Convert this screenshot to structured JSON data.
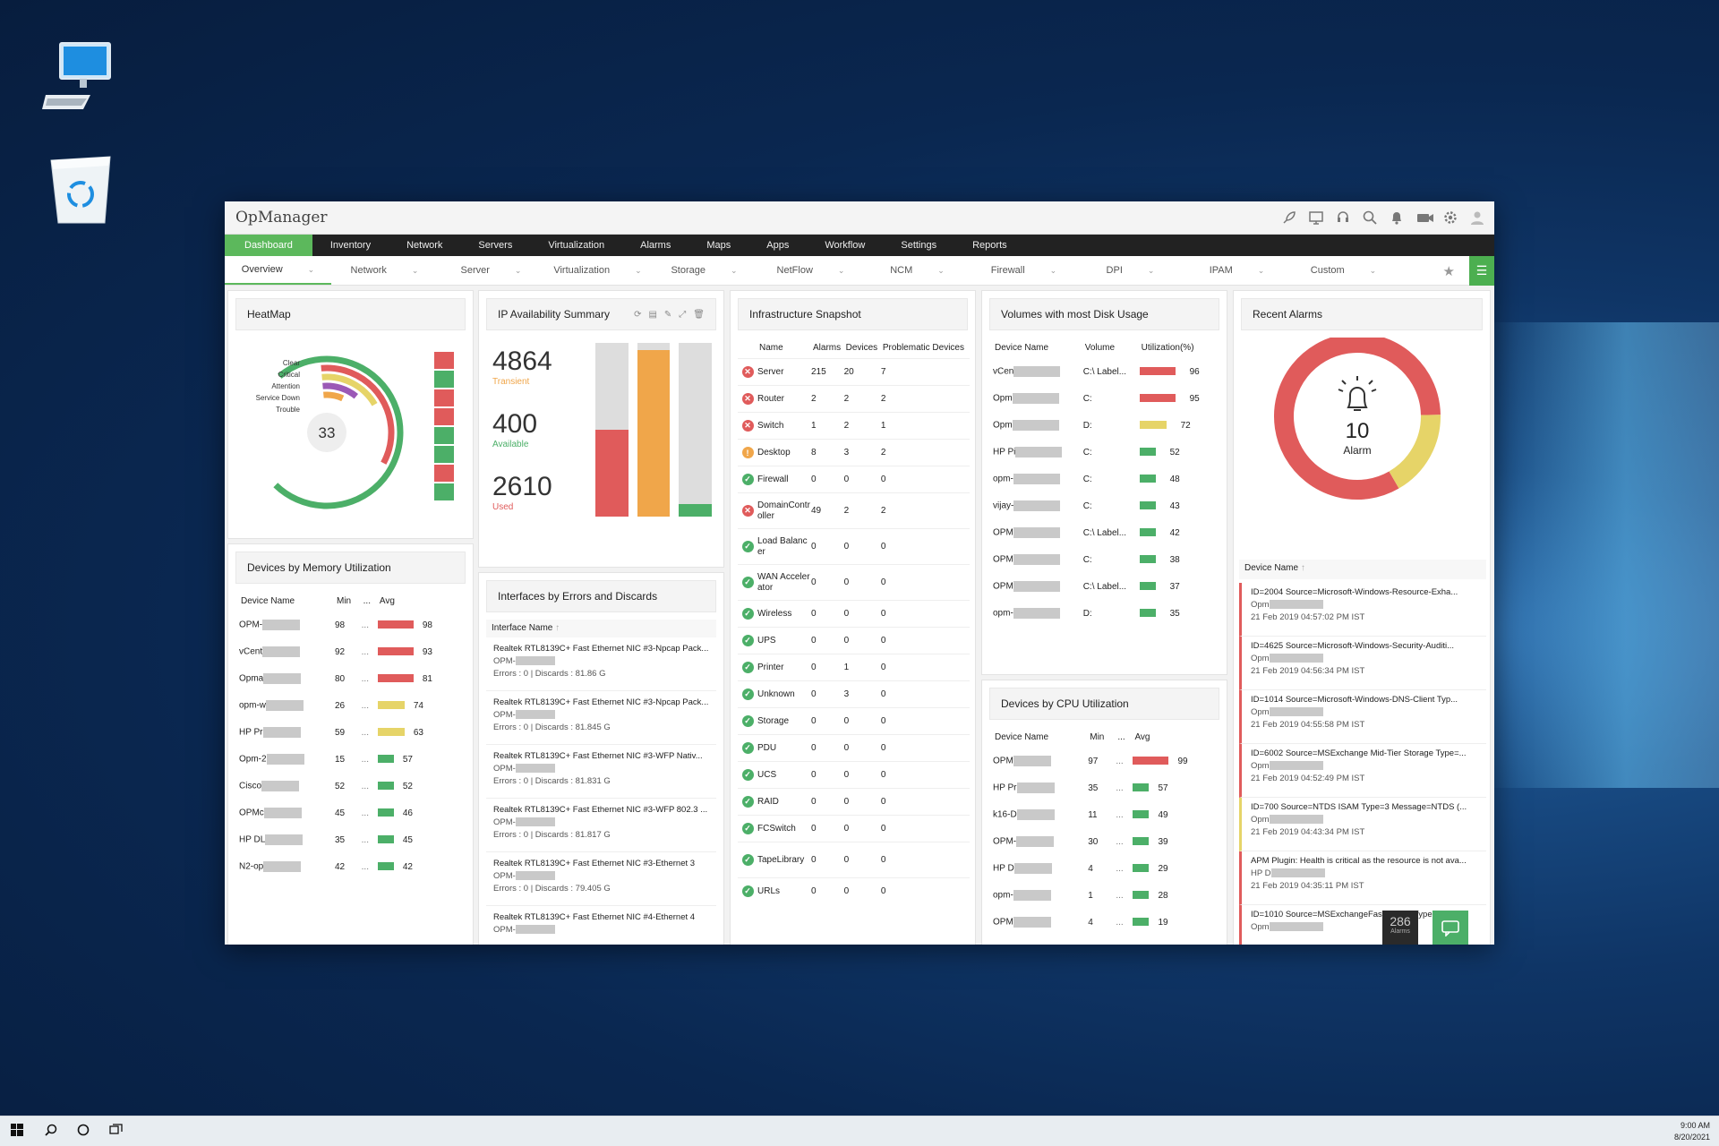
{
  "app": {
    "title": "OpManager"
  },
  "main_nav": [
    "Dashboard",
    "Inventory",
    "Network",
    "Servers",
    "Virtualization",
    "Alarms",
    "Maps",
    "Apps",
    "Workflow",
    "Settings",
    "Reports"
  ],
  "sub_nav": [
    "Overview",
    "Network",
    "Server",
    "Virtualization",
    "Storage",
    "NetFlow",
    "NCM",
    "Firewall",
    "DPI",
    "IPAM",
    "Custom"
  ],
  "heatmap": {
    "title": "HeatMap",
    "legend": [
      "Clear",
      "Critical",
      "Attention",
      "Service Down",
      "Trouble"
    ],
    "count": "33",
    "cells": [
      "red",
      "green",
      "red",
      "red",
      "green",
      "green",
      "red",
      "green"
    ]
  },
  "ip_summary": {
    "title": "IP Availability Summary",
    "stats": [
      {
        "value": "4864",
        "label": "Transient",
        "color": "#f0a64a"
      },
      {
        "value": "400",
        "label": "Available",
        "color": "#4caf68"
      },
      {
        "value": "2610",
        "label": "Used",
        "color": "#e05b5b"
      }
    ],
    "bars": [
      {
        "fill": 0.5,
        "color": "#e05b5b"
      },
      {
        "fill": 0.96,
        "color": "#f0a64a"
      },
      {
        "fill": 0.07,
        "color": "#4caf68"
      }
    ]
  },
  "memory": {
    "title": "Devices by Memory Utilization",
    "headers": [
      "Device Name",
      "Min",
      "...",
      "Avg"
    ],
    "rows": [
      {
        "name": "OPM-",
        "min": "98",
        "dots": "...",
        "avg": "98",
        "color": "red"
      },
      {
        "name": "vCent",
        "min": "92",
        "dots": "...",
        "avg": "93",
        "color": "red"
      },
      {
        "name": "Opma",
        "min": "80",
        "dots": "...",
        "avg": "81",
        "color": "red"
      },
      {
        "name": "opm-w",
        "min": "26",
        "dots": "...",
        "avg": "74",
        "color": "yellow"
      },
      {
        "name": "HP Pr",
        "min": "59",
        "dots": "...",
        "avg": "63",
        "color": "yellow"
      },
      {
        "name": "Opm-2",
        "min": "15",
        "dots": "...",
        "avg": "57",
        "color": "green"
      },
      {
        "name": "Cisco",
        "min": "52",
        "dots": "...",
        "avg": "52",
        "color": "green"
      },
      {
        "name": "OPMc",
        "min": "45",
        "dots": "...",
        "avg": "46",
        "color": "green"
      },
      {
        "name": "HP DL",
        "min": "35",
        "dots": "...",
        "avg": "45",
        "color": "green"
      },
      {
        "name": "N2-op",
        "min": "42",
        "dots": "...",
        "avg": "42",
        "color": "green"
      }
    ]
  },
  "interfaces": {
    "title": "Interfaces by Errors and Discards",
    "header": "Interface Name",
    "rows": [
      {
        "name": "Realtek RTL8139C+ Fast Ethernet NIC #3-Npcap Pack...",
        "device": "OPM-",
        "stats": "Errors : 0 | Discards : 81.86 G"
      },
      {
        "name": "Realtek RTL8139C+ Fast Ethernet NIC #3-Npcap Pack...",
        "device": "OPM-",
        "stats": "Errors : 0 | Discards : 81.845 G"
      },
      {
        "name": "Realtek RTL8139C+ Fast Ethernet NIC #3-WFP Nativ...",
        "device": "OPM-",
        "stats": "Errors : 0 | Discards : 81.831 G"
      },
      {
        "name": "Realtek RTL8139C+ Fast Ethernet NIC #3-WFP 802.3 ...",
        "device": "OPM-",
        "stats": "Errors : 0 | Discards : 81.817 G"
      },
      {
        "name": "Realtek RTL8139C+ Fast Ethernet NIC #3-Ethernet 3",
        "device": "OPM-",
        "stats": "Errors : 0 | Discards : 79.405 G"
      },
      {
        "name": "Realtek RTL8139C+ Fast Ethernet NIC #4-Ethernet 4",
        "device": "OPM-",
        "stats": ""
      }
    ]
  },
  "infra": {
    "title": "Infrastructure Snapshot",
    "headers": [
      "Name",
      "Alarms",
      "Devices",
      "Problematic Devices"
    ],
    "rows": [
      {
        "status": "critical",
        "name": "Server",
        "alarms": "215",
        "devices": "20",
        "prob": "7"
      },
      {
        "status": "critical",
        "name": "Router",
        "alarms": "2",
        "devices": "2",
        "prob": "2"
      },
      {
        "status": "critical",
        "name": "Switch",
        "alarms": "1",
        "devices": "2",
        "prob": "1"
      },
      {
        "status": "warning",
        "name": "Desktop",
        "alarms": "8",
        "devices": "3",
        "prob": "2"
      },
      {
        "status": "ok",
        "name": "Firewall",
        "alarms": "0",
        "devices": "0",
        "prob": "0"
      },
      {
        "status": "critical",
        "name": "DomainController",
        "alarms": "49",
        "devices": "2",
        "prob": "2"
      },
      {
        "status": "ok",
        "name": "Load Balancer",
        "alarms": "0",
        "devices": "0",
        "prob": "0"
      },
      {
        "status": "ok",
        "name": "WAN Accelerator",
        "alarms": "0",
        "devices": "0",
        "prob": "0"
      },
      {
        "status": "ok",
        "name": "Wireless",
        "alarms": "0",
        "devices": "0",
        "prob": "0"
      },
      {
        "status": "ok",
        "name": "UPS",
        "alarms": "0",
        "devices": "0",
        "prob": "0"
      },
      {
        "status": "ok",
        "name": "Printer",
        "alarms": "0",
        "devices": "1",
        "prob": "0"
      },
      {
        "status": "ok",
        "name": "Unknown",
        "alarms": "0",
        "devices": "3",
        "prob": "0"
      },
      {
        "status": "ok",
        "name": "Storage",
        "alarms": "0",
        "devices": "0",
        "prob": "0"
      },
      {
        "status": "ok",
        "name": "PDU",
        "alarms": "0",
        "devices": "0",
        "prob": "0"
      },
      {
        "status": "ok",
        "name": "UCS",
        "alarms": "0",
        "devices": "0",
        "prob": "0"
      },
      {
        "status": "ok",
        "name": "RAID",
        "alarms": "0",
        "devices": "0",
        "prob": "0"
      },
      {
        "status": "ok",
        "name": "FCSwitch",
        "alarms": "0",
        "devices": "0",
        "prob": "0"
      },
      {
        "status": "ok",
        "name": "TapeLibrary",
        "alarms": "0",
        "devices": "0",
        "prob": "0"
      },
      {
        "status": "ok",
        "name": "URLs",
        "alarms": "0",
        "devices": "0",
        "prob": "0"
      }
    ]
  },
  "disk": {
    "title": "Volumes with most Disk Usage",
    "headers": [
      "Device Name",
      "Volume",
      "Utilization(%)"
    ],
    "rows": [
      {
        "name": "vCen",
        "volume": "C:\\ Label...",
        "util": "96",
        "color": "red"
      },
      {
        "name": "Opm",
        "volume": "C:",
        "util": "95",
        "color": "red"
      },
      {
        "name": "Opm",
        "volume": "D:",
        "util": "72",
        "color": "yellow"
      },
      {
        "name": "HP Pi",
        "volume": "C:",
        "util": "52",
        "color": "green"
      },
      {
        "name": "opm-",
        "volume": "C:",
        "util": "48",
        "color": "green"
      },
      {
        "name": "vijay-",
        "volume": "C:",
        "util": "43",
        "color": "green"
      },
      {
        "name": "OPM",
        "volume": "C:\\ Label...",
        "util": "42",
        "color": "green"
      },
      {
        "name": "OPM",
        "volume": "C:",
        "util": "38",
        "color": "green"
      },
      {
        "name": "OPM",
        "volume": "C:\\ Label...",
        "util": "37",
        "color": "green"
      },
      {
        "name": "opm-",
        "volume": "D:",
        "util": "35",
        "color": "green"
      }
    ]
  },
  "cpu": {
    "title": "Devices by CPU Utilization",
    "headers": [
      "Device Name",
      "Min",
      "...",
      "Avg"
    ],
    "rows": [
      {
        "name": "OPM",
        "min": "97",
        "dots": "...",
        "avg": "99",
        "color": "red"
      },
      {
        "name": "HP Pr",
        "min": "35",
        "dots": "...",
        "avg": "57",
        "color": "green"
      },
      {
        "name": "k16-D",
        "min": "11",
        "dots": "...",
        "avg": "49",
        "color": "green"
      },
      {
        "name": "OPM-",
        "min": "30",
        "dots": "...",
        "avg": "39",
        "color": "green"
      },
      {
        "name": "HP D",
        "min": "4",
        "dots": "...",
        "avg": "29",
        "color": "green"
      },
      {
        "name": "opm-",
        "min": "1",
        "dots": "...",
        "avg": "28",
        "color": "green"
      },
      {
        "name": "OPM",
        "min": "4",
        "dots": "...",
        "avg": "19",
        "color": "green"
      }
    ]
  },
  "alarms": {
    "title": "Recent Alarms",
    "count": "10",
    "label": "Alarm",
    "header": "Device Name",
    "donut": [
      {
        "fraction": 0.83,
        "color": "#e05b5b"
      },
      {
        "fraction": 0.17,
        "color": "#e6d468"
      }
    ],
    "rows": [
      {
        "text": "ID=2004 Source=Microsoft-Windows-Resource-Exha...",
        "device": "Opm",
        "time": "21 Feb 2019 04:57:02 PM IST",
        "color": "#e05b5b"
      },
      {
        "text": "ID=4625 Source=Microsoft-Windows-Security-Auditi...",
        "device": "Opm",
        "time": "21 Feb 2019 04:56:34 PM IST",
        "color": "#e05b5b"
      },
      {
        "text": "ID=1014 Source=Microsoft-Windows-DNS-Client Typ...",
        "device": "Opm",
        "time": "21 Feb 2019 04:55:58 PM IST",
        "color": "#e05b5b"
      },
      {
        "text": "ID=6002 Source=MSExchange Mid-Tier Storage Type=...",
        "device": "Opm",
        "time": "21 Feb 2019 04:52:49 PM IST",
        "color": "#e05b5b"
      },
      {
        "text": "ID=700 Source=NTDS ISAM Type=3 Message=NTDS (...",
        "device": "Opm",
        "time": "21 Feb 2019 04:43:34 PM IST",
        "color": "#e6d468"
      },
      {
        "text": "APM Plugin: Health is critical as the resource is not ava...",
        "device": "HP D",
        "time": "21 Feb 2019 04:35:11 PM IST",
        "color": "#e05b5b"
      },
      {
        "text": "ID=1010 Source=MSExchangeFastSearch Type=...",
        "device": "Opm",
        "time": "",
        "color": "#e05b5b"
      }
    ],
    "badge_count": "286",
    "badge_label": "Alarms"
  },
  "taskbar": {
    "time": "9:00 AM",
    "date": "8/20/2021"
  }
}
